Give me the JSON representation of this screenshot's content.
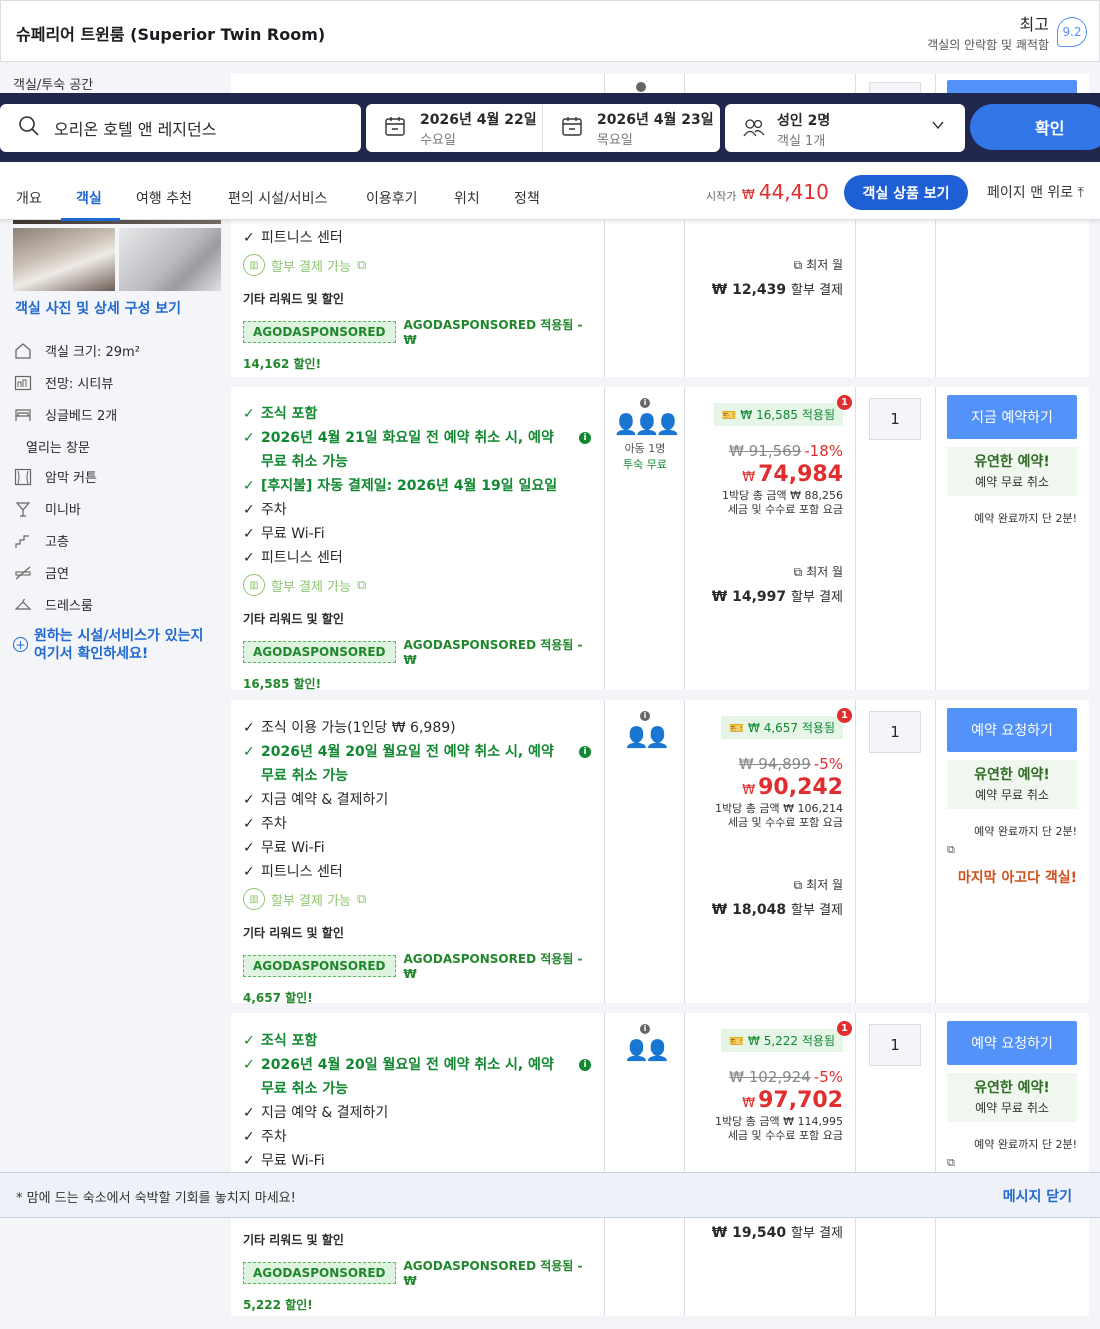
{
  "room": {
    "title": "슈페리어 트윈룸 (Superior Twin Room)",
    "rating_word": "최고",
    "rating_sub": "객실의 안락함 및 쾌적함",
    "rating_score": "9.2"
  },
  "sidebar": {
    "section_label": "객실/투숙 공간",
    "photo_link": "객실 사진 및 상세 구성 보기",
    "amenities": [
      {
        "label": "객실 크기: 29m²",
        "icon": "house-icon"
      },
      {
        "label": "전망: 시티뷰",
        "icon": "city-view-icon"
      },
      {
        "label": "싱글베드 2개",
        "icon": "bed-icon"
      },
      {
        "label": "열리는 창문",
        "icon": ""
      },
      {
        "label": "암막 커튼",
        "icon": "curtain-icon"
      },
      {
        "label": "미니바",
        "icon": "minibar-icon"
      },
      {
        "label": "고층",
        "icon": "stairs-icon"
      },
      {
        "label": "금연",
        "icon": "no-smoking-icon"
      },
      {
        "label": "드레스룸",
        "icon": "hanger-icon"
      }
    ],
    "find_more": "원하는 시설/서비스가 있는지 여기서 확인하세요!"
  },
  "search": {
    "destination": "오리온 호텔 앤 레지던스",
    "checkin_date": "2026년 4월 22일",
    "checkin_day": "수요일",
    "checkout_date": "2026년 4월 23일",
    "checkout_day": "목요일",
    "guests": "성인 2명",
    "rooms": "객실 1개",
    "confirm": "확인"
  },
  "tabs": {
    "items": [
      "개요",
      "객실",
      "여행 추천",
      "편의 시설/서비스",
      "이용후기",
      "위치",
      "정책"
    ],
    "from_label": "시작가",
    "currency": "₩",
    "from_price": "44,410",
    "view_button": "객실 상품 보기",
    "top_link": "페이지 맨 위로"
  },
  "offers": [
    {
      "benefits_tail": [
        "피트니스 센터"
      ],
      "installment": "할부 결제 가능",
      "other_title": "기타 리워드 및 할인",
      "sponsor_tag": "AGODASPONSORED",
      "sponsor_text": "AGODASPONSORED 적용됨 - ₩",
      "sponsor_amount": "14,162 할인!",
      "monthly_label": "최저 월",
      "monthly_amount": "₩ 12,439",
      "monthly_suffix": "할부 결제"
    },
    {
      "benefits": [
        {
          "text": "조식 포함",
          "green": true
        },
        {
          "text": "2026년 4월 21일 화요일 전 예약 취소 시, 예약 무료 취소 가능",
          "green": true,
          "info": true
        },
        {
          "text": "[후지불] 자동 결제일: 2026년 4월 19일 일요일",
          "green": true
        },
        {
          "text": "주차",
          "green": false
        },
        {
          "text": "무료 Wi-Fi",
          "green": false
        },
        {
          "text": "피트니스 센터",
          "green": false
        }
      ],
      "installment": "할부 결제 가능",
      "other_title": "기타 리워드 및 할인",
      "sponsor_tag": "AGODASPONSORED",
      "sponsor_text": "AGODASPONSORED 적용됨 - ₩",
      "sponsor_amount": "16,585 할인!",
      "occupancy_child": "아동 1명",
      "occupancy_free": "투숙 무료",
      "discount_badge": "₩ 16,585 적용됨",
      "badge_count": "1",
      "original_price": "₩ 91,569",
      "discount_pct": "-18%",
      "currency": "₩",
      "final_price": "74,984",
      "night_total": "1박당 총 금액 ₩ 88,256",
      "tax_note": "세금 및 수수료 포함 요금",
      "monthly_label": "최저 월",
      "monthly_amount": "₩ 14,997",
      "monthly_suffix": "할부 결제",
      "qty": "1",
      "book_button": "지금 예약하기",
      "flex_title": "유연한 예약!",
      "flex_sub": "예약 무료 취소",
      "book_note": "예약 완료까지 단 2분!"
    },
    {
      "benefits": [
        {
          "text": "조식 이용 가능(1인당 ₩ 6,989)",
          "green": false
        },
        {
          "text": "2026년 4월 20일 월요일 전 예약 취소 시, 예약 무료 취소 가능",
          "green": true,
          "info": true
        },
        {
          "text": "지금 예약 & 결제하기",
          "green": false
        },
        {
          "text": "주차",
          "green": false
        },
        {
          "text": "무료 Wi-Fi",
          "green": false
        },
        {
          "text": "피트니스 센터",
          "green": false
        }
      ],
      "installment": "할부 결제 가능",
      "other_title": "기타 리워드 및 할인",
      "sponsor_tag": "AGODASPONSORED",
      "sponsor_text": "AGODASPONSORED 적용됨 - ₩",
      "sponsor_amount": "4,657 할인!",
      "discount_badge": "₩ 4,657 적용됨",
      "badge_count": "1",
      "original_price": "₩ 94,899",
      "discount_pct": "-5%",
      "currency": "₩",
      "final_price": "90,242",
      "night_total": "1박당 총 금액 ₩ 106,214",
      "tax_note": "세금 및 수수료 포함 요금",
      "monthly_label": "최저 월",
      "monthly_amount": "₩ 18,048",
      "monthly_suffix": "할부 결제",
      "qty": "1",
      "book_button": "예약 요청하기",
      "flex_title": "유연한 예약!",
      "flex_sub": "예약 무료 취소",
      "book_note": "예약 완료까지 단 2분!",
      "last_room": "마지막 아고다 객실!"
    },
    {
      "benefits": [
        {
          "text": "조식 포함",
          "green": true
        },
        {
          "text": "2026년 4월 20일 월요일 전 예약 취소 시, 예약 무료 취소 가능",
          "green": true,
          "info": true
        },
        {
          "text": "지금 예약 & 결제하기",
          "green": false
        },
        {
          "text": "주차",
          "green": false
        },
        {
          "text": "무료 Wi-Fi",
          "green": false
        }
      ],
      "other_title": "기타 리워드 및 할인",
      "sponsor_tag": "AGODASPONSORED",
      "sponsor_text": "AGODASPONSORED 적용됨 - ₩",
      "sponsor_amount": "5,222 할인!",
      "discount_badge": "₩ 5,222 적용됨",
      "badge_count": "1",
      "original_price": "₩ 102,924",
      "discount_pct": "-5%",
      "currency": "₩",
      "final_price": "97,702",
      "night_total": "1박당 총 금액 ₩ 114,995",
      "tax_note": "세금 및 수수료 포함 요금",
      "monthly_amount": "₩ 19,540",
      "monthly_suffix": "할부 결제",
      "qty": "1",
      "book_button": "예약 요청하기",
      "flex_title": "유연한 예약!",
      "flex_sub": "예약 무료 취소",
      "book_note": "예약 완료까지 단 2분!"
    }
  ],
  "banner": {
    "text": "* 맘에 드는 숙소에서 숙박할 기회를 놓치지 마세요!",
    "close": "메시지 닫기"
  },
  "colors": {
    "accent_blue": "#5392f9",
    "price_red": "#e12d2d",
    "green": "#118830",
    "navy": "#20274d"
  }
}
